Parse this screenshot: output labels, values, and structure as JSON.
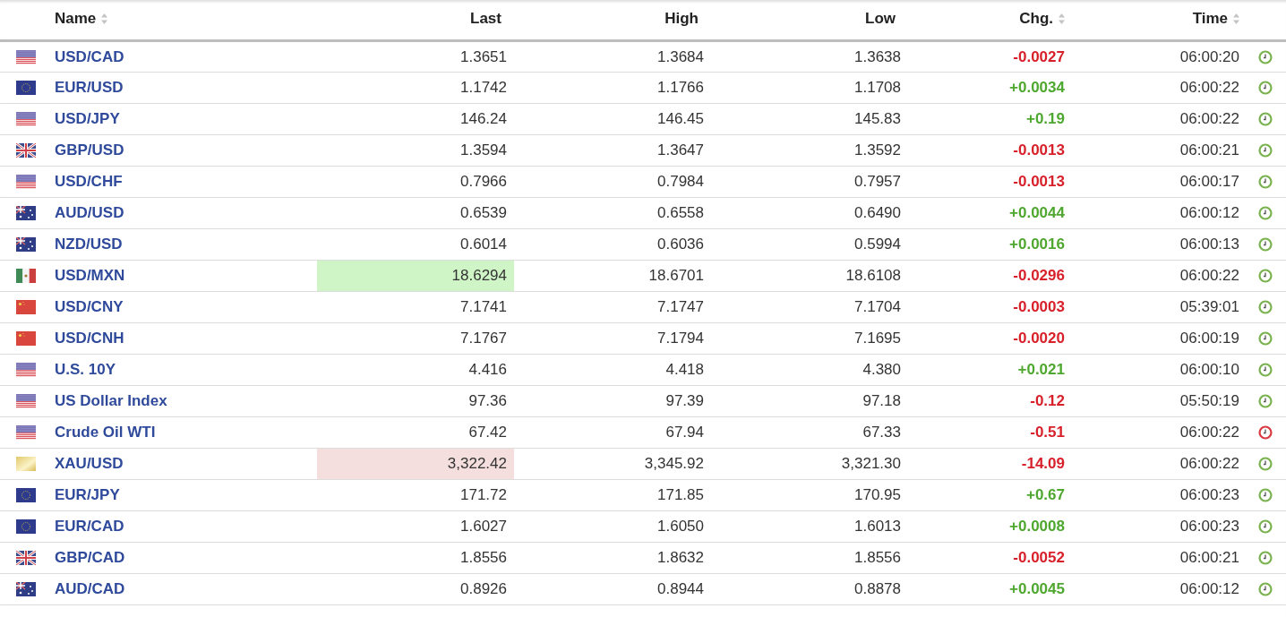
{
  "table": {
    "columns": [
      {
        "label": "Name",
        "sortable": true
      },
      {
        "label": "Last",
        "sortable": false
      },
      {
        "label": "High",
        "sortable": false
      },
      {
        "label": "Low",
        "sortable": false
      },
      {
        "label": "Chg.",
        "sortable": true
      },
      {
        "label": "Time",
        "sortable": true
      }
    ],
    "rows": [
      {
        "kind": "us",
        "name": "USD/CAD",
        "last": "1.3651",
        "flash_up": false,
        "flash_down": false,
        "high": "1.3684",
        "low": "1.3638",
        "chg": "-0.0027",
        "rising": false,
        "time": "06:00:20",
        "market_open": true
      },
      {
        "kind": "eu",
        "name": "EUR/USD",
        "last": "1.1742",
        "flash_up": false,
        "flash_down": false,
        "high": "1.1766",
        "low": "1.1708",
        "chg": "+0.0034",
        "rising": true,
        "time": "06:00:22",
        "market_open": true
      },
      {
        "kind": "us",
        "name": "USD/JPY",
        "last": "146.24",
        "flash_up": false,
        "flash_down": false,
        "high": "146.45",
        "low": "145.83",
        "chg": "+0.19",
        "rising": true,
        "time": "06:00:22",
        "market_open": true
      },
      {
        "kind": "gb",
        "name": "GBP/USD",
        "last": "1.3594",
        "flash_up": false,
        "flash_down": false,
        "high": "1.3647",
        "low": "1.3592",
        "chg": "-0.0013",
        "rising": false,
        "time": "06:00:21",
        "market_open": true
      },
      {
        "kind": "us",
        "name": "USD/CHF",
        "last": "0.7966",
        "flash_up": false,
        "flash_down": false,
        "high": "0.7984",
        "low": "0.7957",
        "chg": "-0.0013",
        "rising": false,
        "time": "06:00:17",
        "market_open": true
      },
      {
        "kind": "au",
        "name": "AUD/USD",
        "last": "0.6539",
        "flash_up": false,
        "flash_down": false,
        "high": "0.6558",
        "low": "0.6490",
        "chg": "+0.0044",
        "rising": true,
        "time": "06:00:12",
        "market_open": true
      },
      {
        "kind": "au",
        "name": "NZD/USD",
        "last": "0.6014",
        "flash_up": false,
        "flash_down": false,
        "high": "0.6036",
        "low": "0.5994",
        "chg": "+0.0016",
        "rising": true,
        "time": "06:00:13",
        "market_open": true
      },
      {
        "kind": "mx",
        "name": "USD/MXN",
        "last": "18.6294",
        "flash_up": true,
        "flash_down": false,
        "high": "18.6701",
        "low": "18.6108",
        "chg": "-0.0296",
        "rising": false,
        "time": "06:00:22",
        "market_open": true
      },
      {
        "kind": "cn",
        "name": "USD/CNY",
        "last": "7.1741",
        "flash_up": false,
        "flash_down": false,
        "high": "7.1747",
        "low": "7.1704",
        "chg": "-0.0003",
        "rising": false,
        "time": "05:39:01",
        "market_open": true
      },
      {
        "kind": "cn",
        "name": "USD/CNH",
        "last": "7.1767",
        "flash_up": false,
        "flash_down": false,
        "high": "7.1794",
        "low": "7.1695",
        "chg": "-0.0020",
        "rising": false,
        "time": "06:00:19",
        "market_open": true
      },
      {
        "kind": "us",
        "name": "U.S. 10Y",
        "last": "4.416",
        "flash_up": false,
        "flash_down": false,
        "high": "4.418",
        "low": "4.380",
        "chg": "+0.021",
        "rising": true,
        "time": "06:00:10",
        "market_open": true
      },
      {
        "kind": "us",
        "name": "US Dollar Index",
        "last": "97.36",
        "flash_up": false,
        "flash_down": false,
        "high": "97.39",
        "low": "97.18",
        "chg": "-0.12",
        "rising": false,
        "time": "05:50:19",
        "market_open": true
      },
      {
        "kind": "us",
        "name": "Crude Oil WTI",
        "last": "67.42",
        "flash_up": false,
        "flash_down": false,
        "high": "67.94",
        "low": "67.33",
        "chg": "-0.51",
        "rising": false,
        "time": "06:00:22",
        "market_open": false
      },
      {
        "kind": "metal",
        "name": "XAU/USD",
        "last": "3,322.42",
        "flash_up": false,
        "flash_down": true,
        "high": "3,345.92",
        "low": "3,321.30",
        "chg": "-14.09",
        "rising": false,
        "time": "06:00:22",
        "market_open": true
      },
      {
        "kind": "eu",
        "name": "EUR/JPY",
        "last": "171.72",
        "flash_up": false,
        "flash_down": false,
        "high": "171.85",
        "low": "170.95",
        "chg": "+0.67",
        "rising": true,
        "time": "06:00:23",
        "market_open": true
      },
      {
        "kind": "eu",
        "name": "EUR/CAD",
        "last": "1.6027",
        "flash_up": false,
        "flash_down": false,
        "high": "1.6050",
        "low": "1.6013",
        "chg": "+0.0008",
        "rising": true,
        "time": "06:00:23",
        "market_open": true
      },
      {
        "kind": "gb",
        "name": "GBP/CAD",
        "last": "1.8556",
        "flash_up": false,
        "flash_down": false,
        "high": "1.8632",
        "low": "1.8556",
        "chg": "-0.0052",
        "rising": false,
        "time": "06:00:21",
        "market_open": true
      },
      {
        "kind": "au",
        "name": "AUD/CAD",
        "last": "0.8926",
        "flash_up": false,
        "flash_down": false,
        "high": "0.8944",
        "low": "0.8878",
        "chg": "+0.0045",
        "rising": true,
        "time": "06:00:12",
        "market_open": true
      }
    ]
  }
}
